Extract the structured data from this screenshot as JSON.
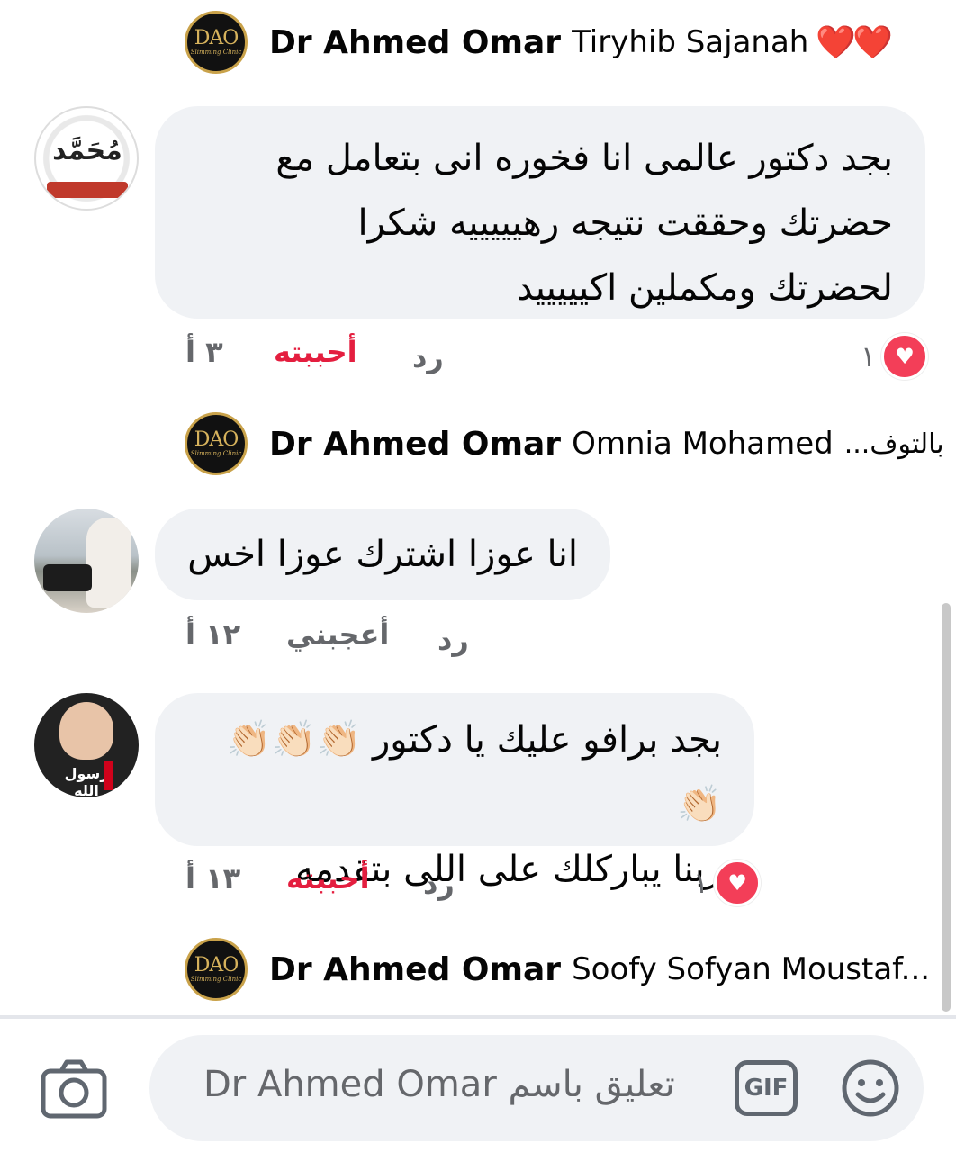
{
  "comments": [
    {
      "reply_preview": {
        "author": "Dr Ahmed Omar",
        "text": "Tiryhib Sajanah",
        "emoji": "❤️❤️"
      },
      "text_lines": [
        "بجد دكتور عالمى انا فخوره انى بتعامل مع",
        "حضرتك وحققت نتيجه رهيييييه شكرا",
        "لحضرتك ومكملين اكيييييد"
      ],
      "time": "٣ أ",
      "like_label": "أحببته",
      "reply_label": "رد",
      "reaction_count": "١"
    },
    {
      "reply_preview": {
        "author": "Dr Ahmed Omar",
        "text": "Omnia Mohamed",
        "rtl_tail": "بالتوف..."
      },
      "text_lines": [
        "انا عوزا اشترك عوزا اخس"
      ],
      "time": "١٢ أ",
      "like_label": "أعجبني",
      "reply_label": "رد"
    },
    {
      "text_lines": [
        "بجد برافو عليك يا دكتور 👏🏻👏🏻👏🏻👏🏻",
        "ربنا يباركلك على اللى بتقدمه"
      ],
      "time": "١٣ أ",
      "like_label": "أحببته",
      "reply_label": "رد",
      "reaction_count": "١"
    }
  ],
  "last_reply_preview": {
    "author": "Dr Ahmed Omar",
    "text": "Soofy Sofyan Moustaf..."
  },
  "avatar_dao": {
    "mark": "DAO",
    "tagline": "Slimming Clinic"
  },
  "avatar1_mark": "مُحَمَّد",
  "avatar3_mark": "رسول الله",
  "composer": {
    "placeholder": "تعليق باسم Dr Ahmed Omar",
    "gif_label": "GIF"
  },
  "colors": {
    "accent_red": "#e41e3f",
    "bubble": "#f0f2f5",
    "meta": "#65676b"
  }
}
